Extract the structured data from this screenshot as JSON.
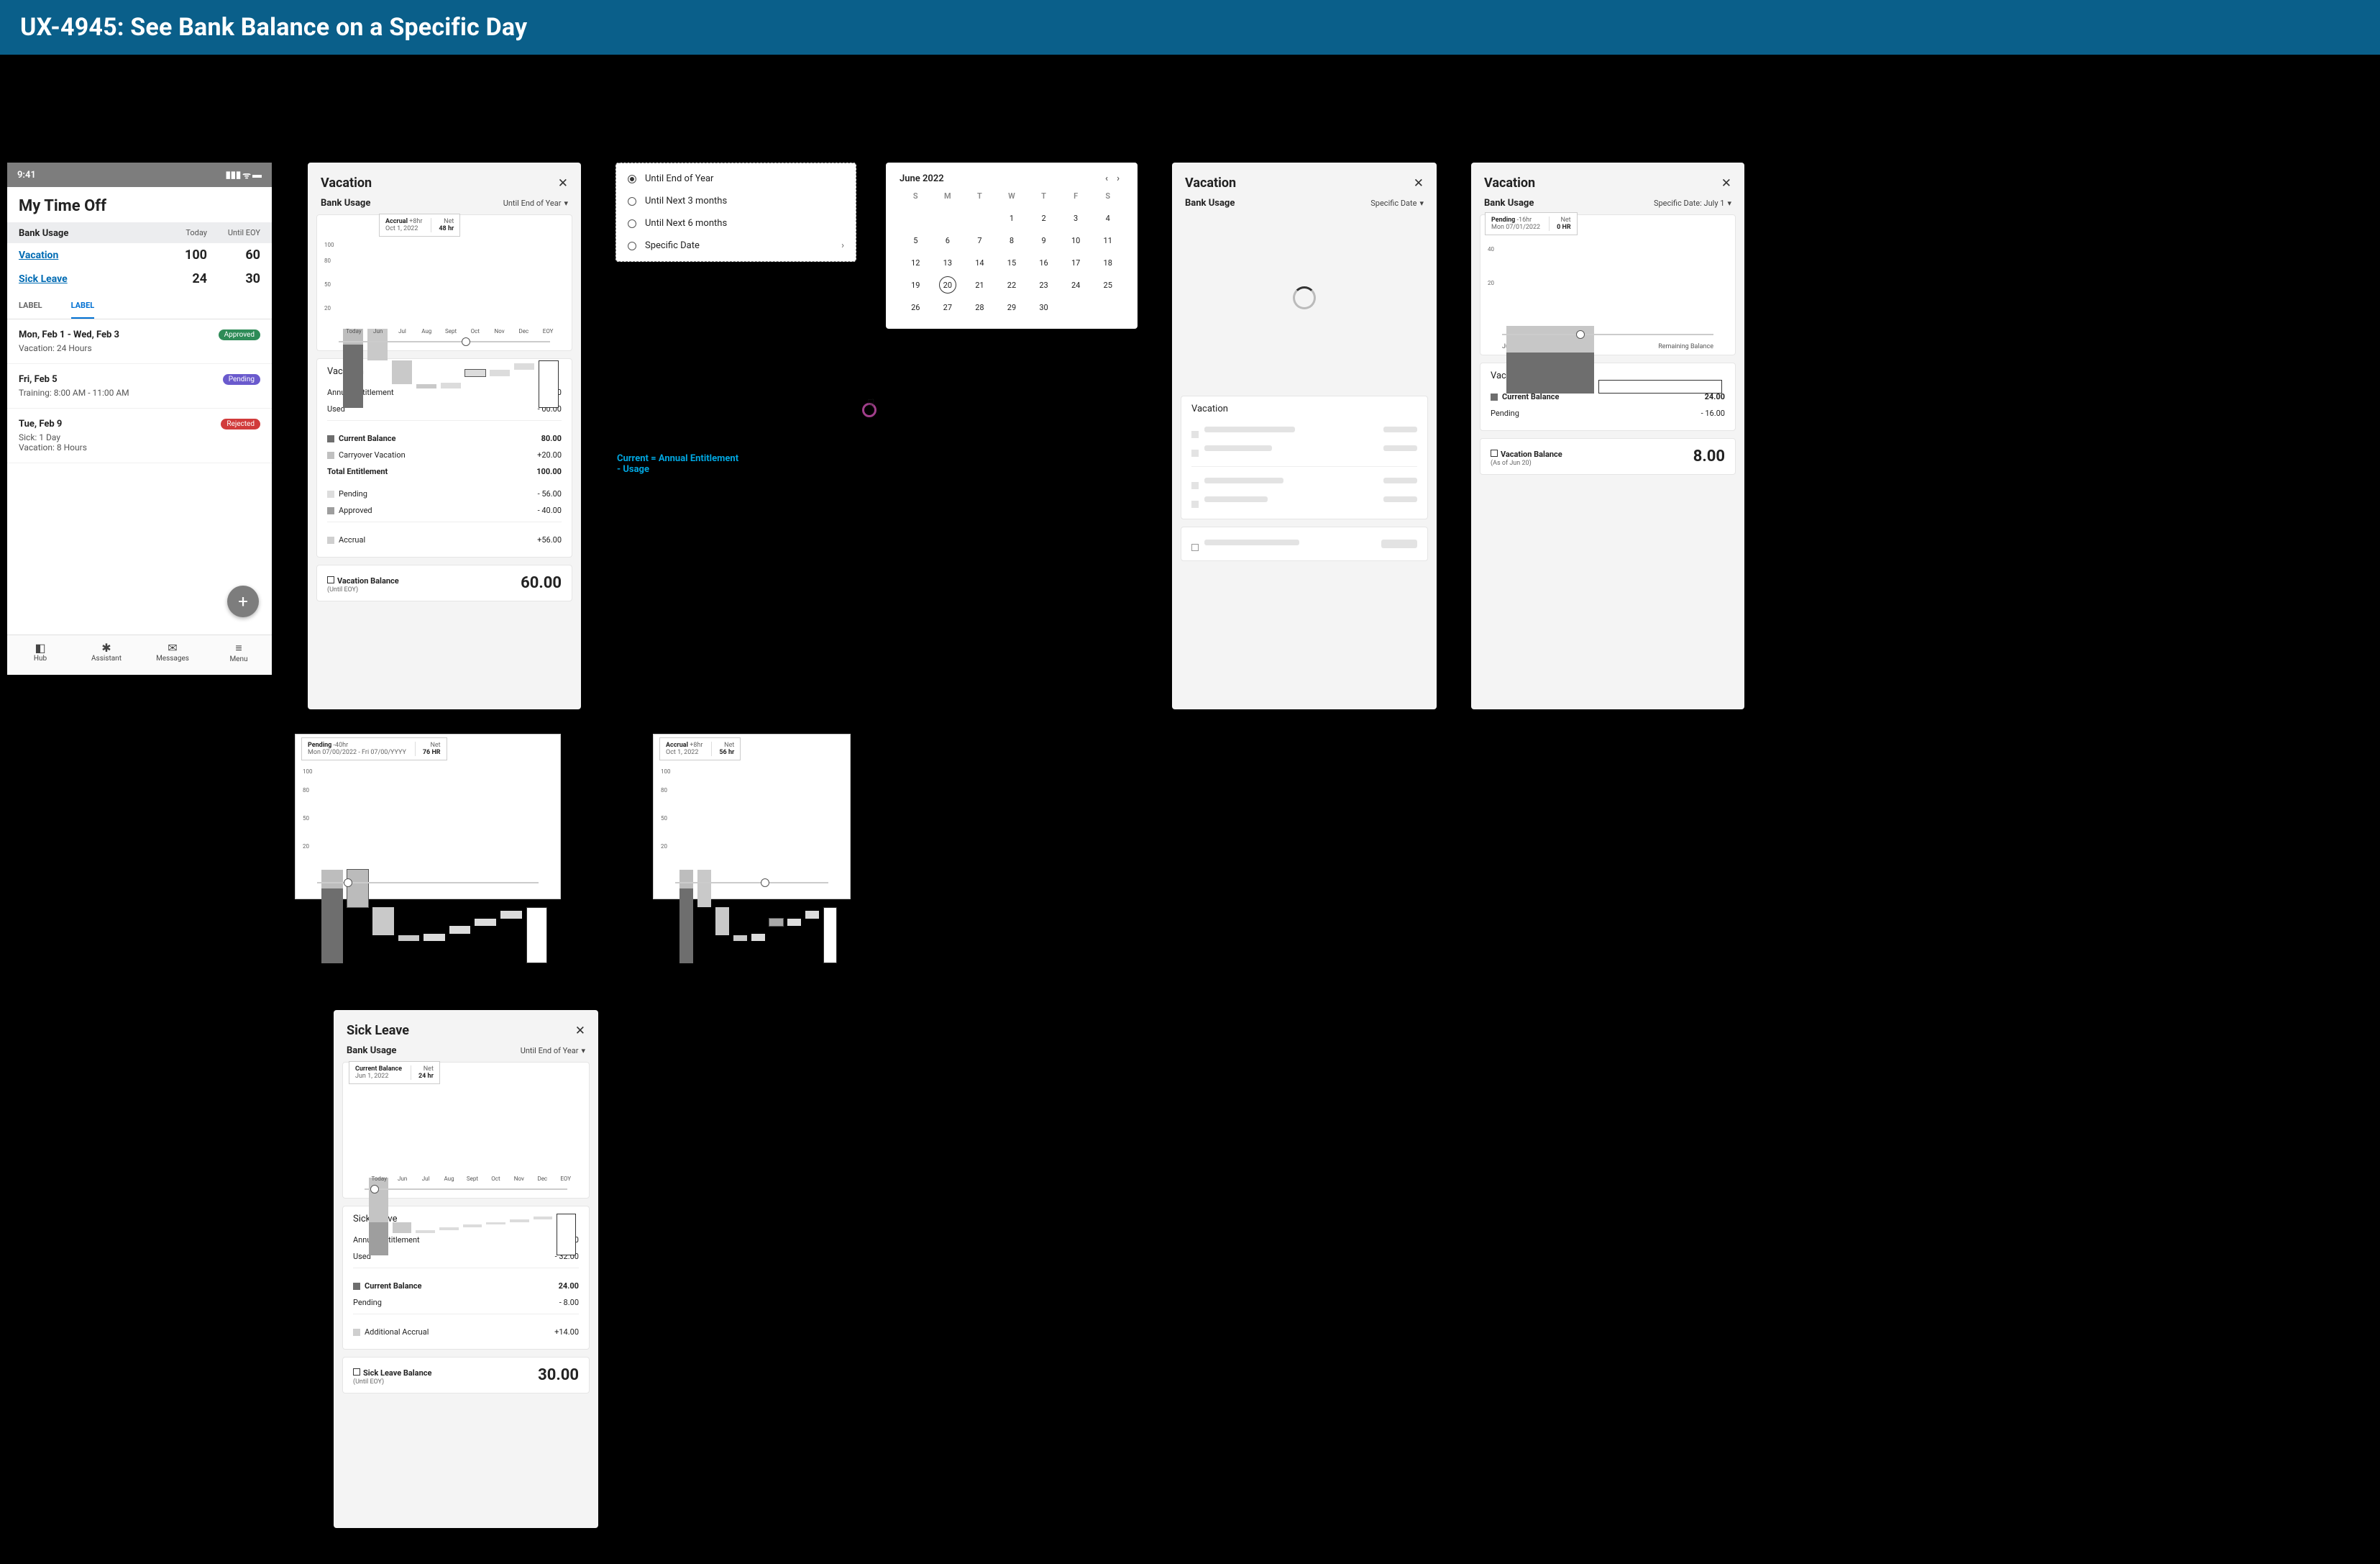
{
  "header": {
    "title": "UX-4945: See Bank Balance on a Specific Day"
  },
  "note": {
    "formula_l1": "Current = Annual Entitlement",
    "formula_l2": "- Usage"
  },
  "p1": {
    "time": "9:41",
    "title": "My Time Off",
    "bank": {
      "label": "Bank Usage",
      "col1": "Today",
      "col2": "Until EOY",
      "rows": [
        {
          "name": "Vacation",
          "v1": "100",
          "v2": "60"
        },
        {
          "name": "Sick Leave",
          "v1": "24",
          "v2": "30"
        }
      ]
    },
    "tabs": [
      "LABEL",
      "LABEL"
    ],
    "requests": [
      {
        "title": "Mon, Feb 1 - Wed, Feb 3",
        "detail": "Vacation:  24 Hours",
        "pill": "Approved",
        "pillClass": "approved"
      },
      {
        "title": "Fri, Feb 5",
        "detail": "Training:  8:00 AM - 11:00 AM",
        "pill": "Pending",
        "pillClass": "pending"
      },
      {
        "title": "Tue, Feb 9",
        "detail": "Sick:  1 Day",
        "detail2": "Vacation:  8 Hours",
        "pill": "Rejected",
        "pillClass": "rejected"
      }
    ],
    "nav": [
      {
        "icon": "◧",
        "label": "Hub"
      },
      {
        "icon": "✱",
        "label": "Assistant"
      },
      {
        "icon": "✉",
        "label": "Messages"
      },
      {
        "icon": "≡",
        "label": "Menu"
      }
    ],
    "fab": "+"
  },
  "p2": {
    "title": "Vacation",
    "bank_usage": "Bank Usage",
    "filter": "Until End of Year",
    "tooltip": {
      "h": "Accrual",
      "delta": "+8hr",
      "date": "Oct 1, 2022",
      "nh": "Net",
      "nv": "48 hr"
    },
    "xlabels": [
      "Today",
      "Jun",
      "Jul",
      "Aug",
      "Sept",
      "Oct",
      "Nov",
      "Dec",
      "EOY"
    ],
    "ylabels": [
      "100",
      "80",
      "50",
      "20"
    ],
    "details": {
      "title": "Vacation",
      "rows": [
        [
          "Annual Entitlement",
          "80.00"
        ],
        [
          "Used",
          "- 00.00"
        ]
      ],
      "mid": [
        [
          "Current Balance",
          "80.00",
          "sw-cur"
        ],
        [
          "Carryover Vacation",
          "+20.00",
          "sw-co"
        ]
      ],
      "totl": [
        "Total Entitlement",
        "100.00"
      ],
      "rows2": [
        [
          "Pending",
          "- 56.00",
          "sw-pen"
        ],
        [
          "Approved",
          "- 40.00",
          "sw-app"
        ]
      ],
      "accr": [
        "Accrual",
        "+56.00",
        "sw-acc"
      ]
    },
    "balance": {
      "label": "Vacation Balance",
      "sub": "(Until EOY)",
      "value": "60.00"
    }
  },
  "p3": {
    "items": [
      "Until End of Year",
      "Until Next 3 months",
      "Until Next 6 months",
      "Specific Date"
    ],
    "selectedIndex": 0
  },
  "p4": {
    "month": "June 2022",
    "dow": [
      "S",
      "M",
      "T",
      "W",
      "T",
      "F",
      "S"
    ],
    "firstDayOffset": 3,
    "daysInMonth": 30,
    "selected": 20
  },
  "p5": {
    "title": "Vacation",
    "bank_usage": "Bank Usage",
    "filter": "Specific Date",
    "details_title": "Vacation"
  },
  "p6": {
    "title": "Vacation",
    "bank_usage": "Bank Usage",
    "filter": "Specific Date: July 1",
    "tooltip": {
      "h": "Pending",
      "delta": "-16hr",
      "date": "Mon 07/01/2022",
      "nh": "Net",
      "nv": "0 HR"
    },
    "xlabels": [
      "July 1",
      "Remaining Balance"
    ],
    "ylabels": [
      "40",
      "20"
    ],
    "details": {
      "title": "Vacation",
      "rows": [
        [
          "Current Balance",
          "24.00",
          "sw-cur"
        ],
        [
          "Pending",
          "- 16.00",
          ""
        ]
      ]
    },
    "balance": {
      "label": "Vacation Balance",
      "sub": "(As of Jun 20)",
      "value": "8.00"
    }
  },
  "p7": {
    "tooltip": {
      "h": "Pending",
      "delta": "-40hr",
      "date": "Mon 07/00/2022 - Fri 07/00/YYYY",
      "nh": "Net",
      "nv": "76 HR"
    },
    "ylabels": [
      "100",
      "80",
      "50",
      "20"
    ]
  },
  "p8": {
    "tooltip": {
      "h": "Accrual",
      "delta": "+8hr",
      "date": "Oct 1, 2022",
      "nh": "Net",
      "nv": "56 hr"
    },
    "ylabels": [
      "100",
      "80",
      "50",
      "20"
    ]
  },
  "p9": {
    "title": "Sick Leave",
    "bank_usage": "Bank Usage",
    "filter": "Until End of Year",
    "tooltip": {
      "h": "Current Balance",
      "date": "Jun 1, 2022",
      "nh": "Net",
      "nv": "24 hr"
    },
    "xlabels": [
      "Today",
      "Jun",
      "Jul",
      "Aug",
      "Sept",
      "Oct",
      "Nov",
      "Dec",
      "EOY"
    ],
    "details": {
      "title": "Sick Leave",
      "rows": [
        [
          "Annual Entitlement",
          "56.00"
        ],
        [
          "Used",
          "- 32.00"
        ]
      ],
      "mid": [
        [
          "Current Balance",
          "24.00",
          "sw-cur"
        ],
        [
          "Pending",
          "- 8.00",
          ""
        ]
      ],
      "accr": [
        "Additional Accrual",
        "+14.00",
        "sw-acc"
      ]
    },
    "balance": {
      "label": "Sick Leave Balance",
      "sub": "(Until EOY)",
      "value": "30.00"
    }
  },
  "chart_data": [
    {
      "id": "p2_chart",
      "type": "waterfall",
      "ylim": [
        0,
        105
      ],
      "series": [
        {
          "label": "Today",
          "top": 100,
          "bot": 0,
          "color": "#6e6e6e",
          "overlay": {
            "top": 100,
            "bot": 80,
            "color": "#bdbdbd"
          }
        },
        {
          "label": "Jun",
          "top": 100,
          "bot": 60,
          "color": "#c9c9c9"
        },
        {
          "label": "Jul",
          "top": 60,
          "bot": 30,
          "color": "#c9c9c9"
        },
        {
          "label": "Aug",
          "top": 30,
          "bot": 24,
          "color": "#c9c9c9"
        },
        {
          "label": "Sept",
          "top": 32,
          "bot": 24,
          "color": "#dcdcdc"
        },
        {
          "label": "Oct",
          "top": 48,
          "bot": 40,
          "color": "#dcdcdc",
          "highlight": true
        },
        {
          "label": "Nov",
          "top": 48,
          "bot": 40,
          "color": "#dcdcdc"
        },
        {
          "label": "Dec",
          "top": 56,
          "bot": 48,
          "color": "#dcdcdc"
        },
        {
          "label": "EOY",
          "top": 60,
          "bot": 0,
          "color": "#fff",
          "border": "#333"
        }
      ],
      "indicator_pos": 0.58
    },
    {
      "id": "p6_chart",
      "type": "bar",
      "ylim": [
        0,
        45
      ],
      "categories": [
        "July 1",
        "Remaining Balance"
      ],
      "series": [
        {
          "stack": [
            {
              "v": 24,
              "color": "#6e6e6e"
            },
            {
              "v": 16,
              "color": "#c7c7c7"
            }
          ]
        },
        {
          "stack": [
            {
              "v": 8,
              "color": "#fff",
              "border": "#333"
            }
          ]
        }
      ],
      "indicator_pos": 0.35
    },
    {
      "id": "p7_chart",
      "type": "waterfall",
      "ylim": [
        0,
        105
      ],
      "series": [
        {
          "top": 100,
          "bot": 0,
          "color": "#6e6e6e",
          "overlay": {
            "top": 100,
            "bot": 80,
            "color": "#bdbdbd"
          }
        },
        {
          "top": 100,
          "bot": 60,
          "color": "#bbb",
          "highlight": true
        },
        {
          "top": 60,
          "bot": 30,
          "color": "#c9c9c9"
        },
        {
          "top": 30,
          "bot": 24,
          "color": "#c9c9c9"
        },
        {
          "top": 32,
          "bot": 24,
          "color": "#dcdcdc"
        },
        {
          "top": 40,
          "bot": 32,
          "color": "#dcdcdc"
        },
        {
          "top": 48,
          "bot": 40,
          "color": "#dcdcdc"
        },
        {
          "top": 56,
          "bot": 48,
          "color": "#dcdcdc"
        },
        {
          "top": 60,
          "bot": 0,
          "color": "#fff",
          "border": "#333"
        }
      ],
      "indicator_pos": 0.12
    },
    {
      "id": "p8_chart",
      "type": "waterfall",
      "ylim": [
        0,
        105
      ],
      "series": [
        {
          "top": 100,
          "bot": 0,
          "color": "#6e6e6e",
          "overlay": {
            "top": 100,
            "bot": 80,
            "color": "#bdbdbd"
          }
        },
        {
          "top": 100,
          "bot": 60,
          "color": "#c9c9c9"
        },
        {
          "top": 60,
          "bot": 30,
          "color": "#c9c9c9"
        },
        {
          "top": 30,
          "bot": 24,
          "color": "#c9c9c9"
        },
        {
          "top": 32,
          "bot": 24,
          "color": "#dcdcdc"
        },
        {
          "top": 48,
          "bot": 40,
          "color": "#a8a8a8",
          "highlight": true
        },
        {
          "top": 48,
          "bot": 40,
          "color": "#dcdcdc"
        },
        {
          "top": 56,
          "bot": 48,
          "color": "#dcdcdc"
        },
        {
          "top": 60,
          "bot": 0,
          "color": "#fff",
          "border": "#333"
        }
      ],
      "indicator_pos": 0.56
    },
    {
      "id": "p9_chart",
      "type": "waterfall",
      "ylim": [
        0,
        60
      ],
      "series": [
        {
          "label": "Today",
          "top": 56,
          "bot": 0,
          "color": "#9e9e9e",
          "overlay": {
            "top": 56,
            "bot": 24,
            "color": "#c4c4c4"
          }
        },
        {
          "label": "Jun",
          "top": 24,
          "bot": 16,
          "color": "#c9c9c9"
        },
        {
          "label": "Jul",
          "top": 18,
          "bot": 16,
          "color": "#dcdcdc"
        },
        {
          "label": "Aug",
          "top": 20,
          "bot": 18,
          "color": "#dcdcdc"
        },
        {
          "label": "Sept",
          "top": 22,
          "bot": 20,
          "color": "#dcdcdc"
        },
        {
          "label": "Oct",
          "top": 24,
          "bot": 22,
          "color": "#dcdcdc"
        },
        {
          "label": "Nov",
          "top": 26,
          "bot": 24,
          "color": "#dcdcdc"
        },
        {
          "label": "Dec",
          "top": 28,
          "bot": 26,
          "color": "#dcdcdc"
        },
        {
          "label": "EOY",
          "top": 30,
          "bot": 0,
          "color": "#fff",
          "border": "#333"
        }
      ],
      "indicator_pos": 0.03
    }
  ]
}
